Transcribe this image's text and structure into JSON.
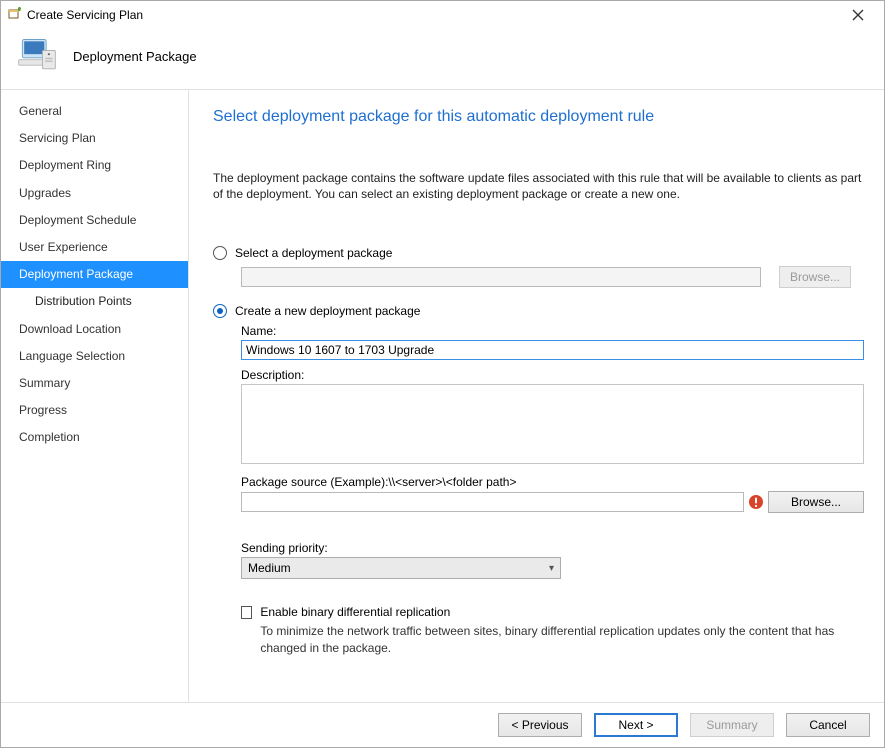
{
  "window": {
    "title": "Create Servicing Plan"
  },
  "banner": {
    "title": "Deployment Package"
  },
  "sidebar": {
    "items": [
      {
        "label": "General"
      },
      {
        "label": "Servicing Plan"
      },
      {
        "label": "Deployment Ring"
      },
      {
        "label": "Upgrades"
      },
      {
        "label": "Deployment Schedule"
      },
      {
        "label": "User Experience"
      },
      {
        "label": "Deployment Package"
      },
      {
        "label": "Distribution Points"
      },
      {
        "label": "Download Location"
      },
      {
        "label": "Language Selection"
      },
      {
        "label": "Summary"
      },
      {
        "label": "Progress"
      },
      {
        "label": "Completion"
      }
    ],
    "selectedIndex": "6"
  },
  "main": {
    "heading": "Select deployment package for this automatic deployment rule",
    "intro": "The deployment package contains the software update files associated with this rule that will be available to clients as part of the deployment. You can select an existing deployment package or create a new one.",
    "option_select_label": "Select a deployment package",
    "option_select_field_value": "",
    "browse_disabled_label": "Browse...",
    "option_create_label": "Create a new deployment package",
    "name_label": "Name:",
    "name_value": "Windows 10 1607 to 1703 Upgrade",
    "description_label": "Description:",
    "description_value": "",
    "pkg_source_label": "Package source (Example):\\\\<server>\\<folder path>",
    "pkg_source_value": "",
    "browse_enabled_label": "Browse...",
    "sending_priority_label": "Sending priority:",
    "sending_priority_value": "Medium",
    "enable_bdr_label": "Enable binary differential replication",
    "enable_bdr_sub": "To minimize the network traffic between sites, binary differential replication updates only the content that has changed in the package."
  },
  "footer": {
    "previous": "< Previous",
    "next": "Next >",
    "summary": "Summary",
    "cancel": "Cancel"
  }
}
